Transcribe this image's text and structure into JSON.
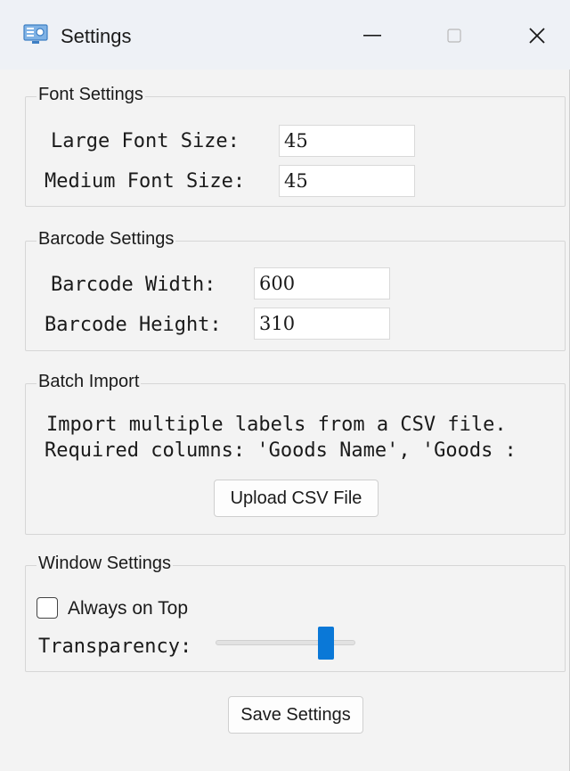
{
  "window": {
    "title": "Settings",
    "icon": "settings-app-icon",
    "controls": [
      "minimize-icon",
      "maximize-icon",
      "close-icon"
    ]
  },
  "font_settings": {
    "legend": "Font Settings",
    "large_label": "Large Font Size:",
    "large_value": "45",
    "medium_label": "Medium Font Size:",
    "medium_value": "45"
  },
  "barcode_settings": {
    "legend": "Barcode Settings",
    "width_label": "Barcode Width:",
    "width_value": "600",
    "height_label": "Barcode Height:",
    "height_value": "310"
  },
  "batch_import": {
    "legend": "Batch Import",
    "line1": "Import multiple labels from a CSV file.",
    "line2": "Required columns: 'Goods Name', 'Goods :",
    "upload_label": "Upload CSV File"
  },
  "window_settings": {
    "legend": "Window Settings",
    "always_on_top_label": "Always on Top",
    "always_on_top_checked": false,
    "transparency_label": "Transparency:",
    "transparency_level": 0.83
  },
  "save_label": "Save Settings",
  "colors": {
    "accent": "#0a78d7",
    "background": "#f3f3f3",
    "titlebar": "#eef1f6"
  }
}
